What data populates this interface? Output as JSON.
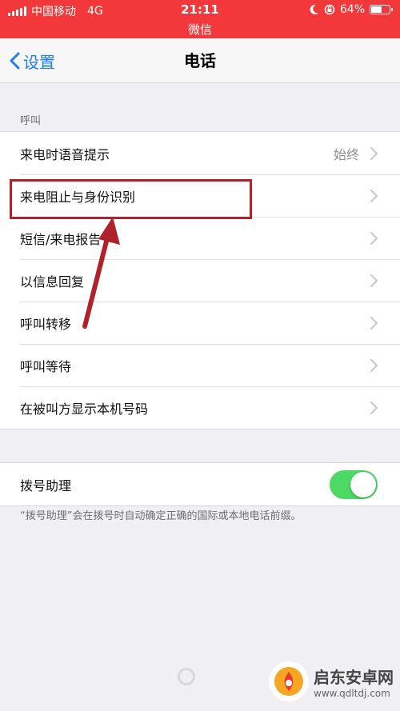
{
  "status_bar": {
    "carrier": "中国移动",
    "network": "4G",
    "time": "21:11",
    "app": "微信",
    "battery": "64%",
    "battery_level": 0.64
  },
  "nav": {
    "back_label": "设置",
    "title": "电话"
  },
  "calls_section": {
    "header": "呼叫",
    "rows": [
      {
        "label": "来电时语音提示",
        "value": "始终"
      },
      {
        "label": "来电阻止与身份识别"
      },
      {
        "label": "短信/来电报告"
      },
      {
        "label": "以信息回复"
      },
      {
        "label": "呼叫转移"
      },
      {
        "label": "呼叫等待"
      },
      {
        "label": "在被叫方显示本机号码"
      }
    ]
  },
  "dial_assist": {
    "label": "拨号助理",
    "enabled": true,
    "note": "“拨号助理”会在拨号时自动确定正确的国际或本地电话前缀。"
  },
  "watermark": {
    "name": "启东安卓网",
    "url": "www.qdltdj.com"
  },
  "colors": {
    "status_bar": "#f2383a",
    "accent": "#1e7cf5",
    "toggle_on": "#4cd964",
    "annotation": "#b0222a"
  }
}
